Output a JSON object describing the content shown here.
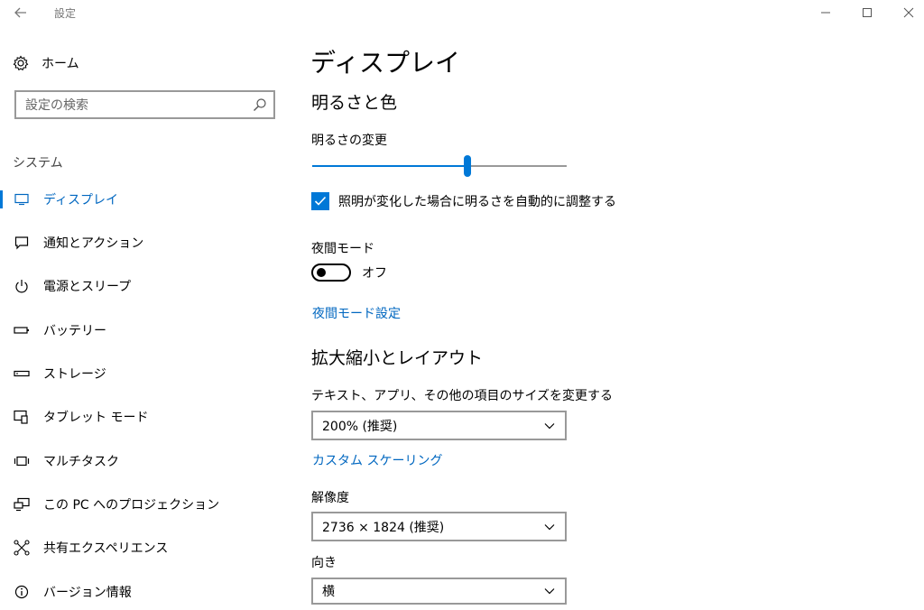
{
  "window": {
    "title": "設定"
  },
  "sidebar": {
    "home_label": "ホーム",
    "search_placeholder": "設定の検索",
    "section_label": "システム",
    "items": [
      {
        "label": "ディスプレイ",
        "icon": "monitor-icon",
        "active": true
      },
      {
        "label": "通知とアクション",
        "icon": "notification-icon",
        "active": false
      },
      {
        "label": "電源とスリープ",
        "icon": "power-icon",
        "active": false
      },
      {
        "label": "バッテリー",
        "icon": "battery-icon",
        "active": false
      },
      {
        "label": "ストレージ",
        "icon": "storage-icon",
        "active": false
      },
      {
        "label": "タブレット モード",
        "icon": "tablet-mode-icon",
        "active": false
      },
      {
        "label": "マルチタスク",
        "icon": "multitask-icon",
        "active": false
      },
      {
        "label": "この PC へのプロジェクション",
        "icon": "projection-icon",
        "active": false
      },
      {
        "label": "共有エクスペリエンス",
        "icon": "shared-experience-icon",
        "active": false
      },
      {
        "label": "バージョン情報",
        "icon": "info-icon",
        "active": false
      }
    ]
  },
  "main": {
    "title": "ディスプレイ",
    "brightness": {
      "heading": "明るさと色",
      "change_label": "明るさの変更",
      "slider_value_percent": 61,
      "auto_checkbox_label": "照明が変化した場合に明るさを自動的に調整する",
      "auto_checked": true
    },
    "night_mode": {
      "label": "夜間モード",
      "toggle_state": "オフ",
      "settings_link": "夜間モード設定"
    },
    "scale_layout": {
      "heading": "拡大縮小とレイアウト",
      "size_label": "テキスト、アプリ、その他の項目のサイズを変更する",
      "size_value": "200% (推奨)",
      "custom_link": "カスタム スケーリング",
      "resolution_label": "解像度",
      "resolution_value": "2736 × 1824 (推奨)",
      "orientation_label": "向き",
      "orientation_value": "横"
    }
  },
  "colors": {
    "accent": "#0078d7",
    "link": "#0067c0",
    "track": "#999999"
  }
}
